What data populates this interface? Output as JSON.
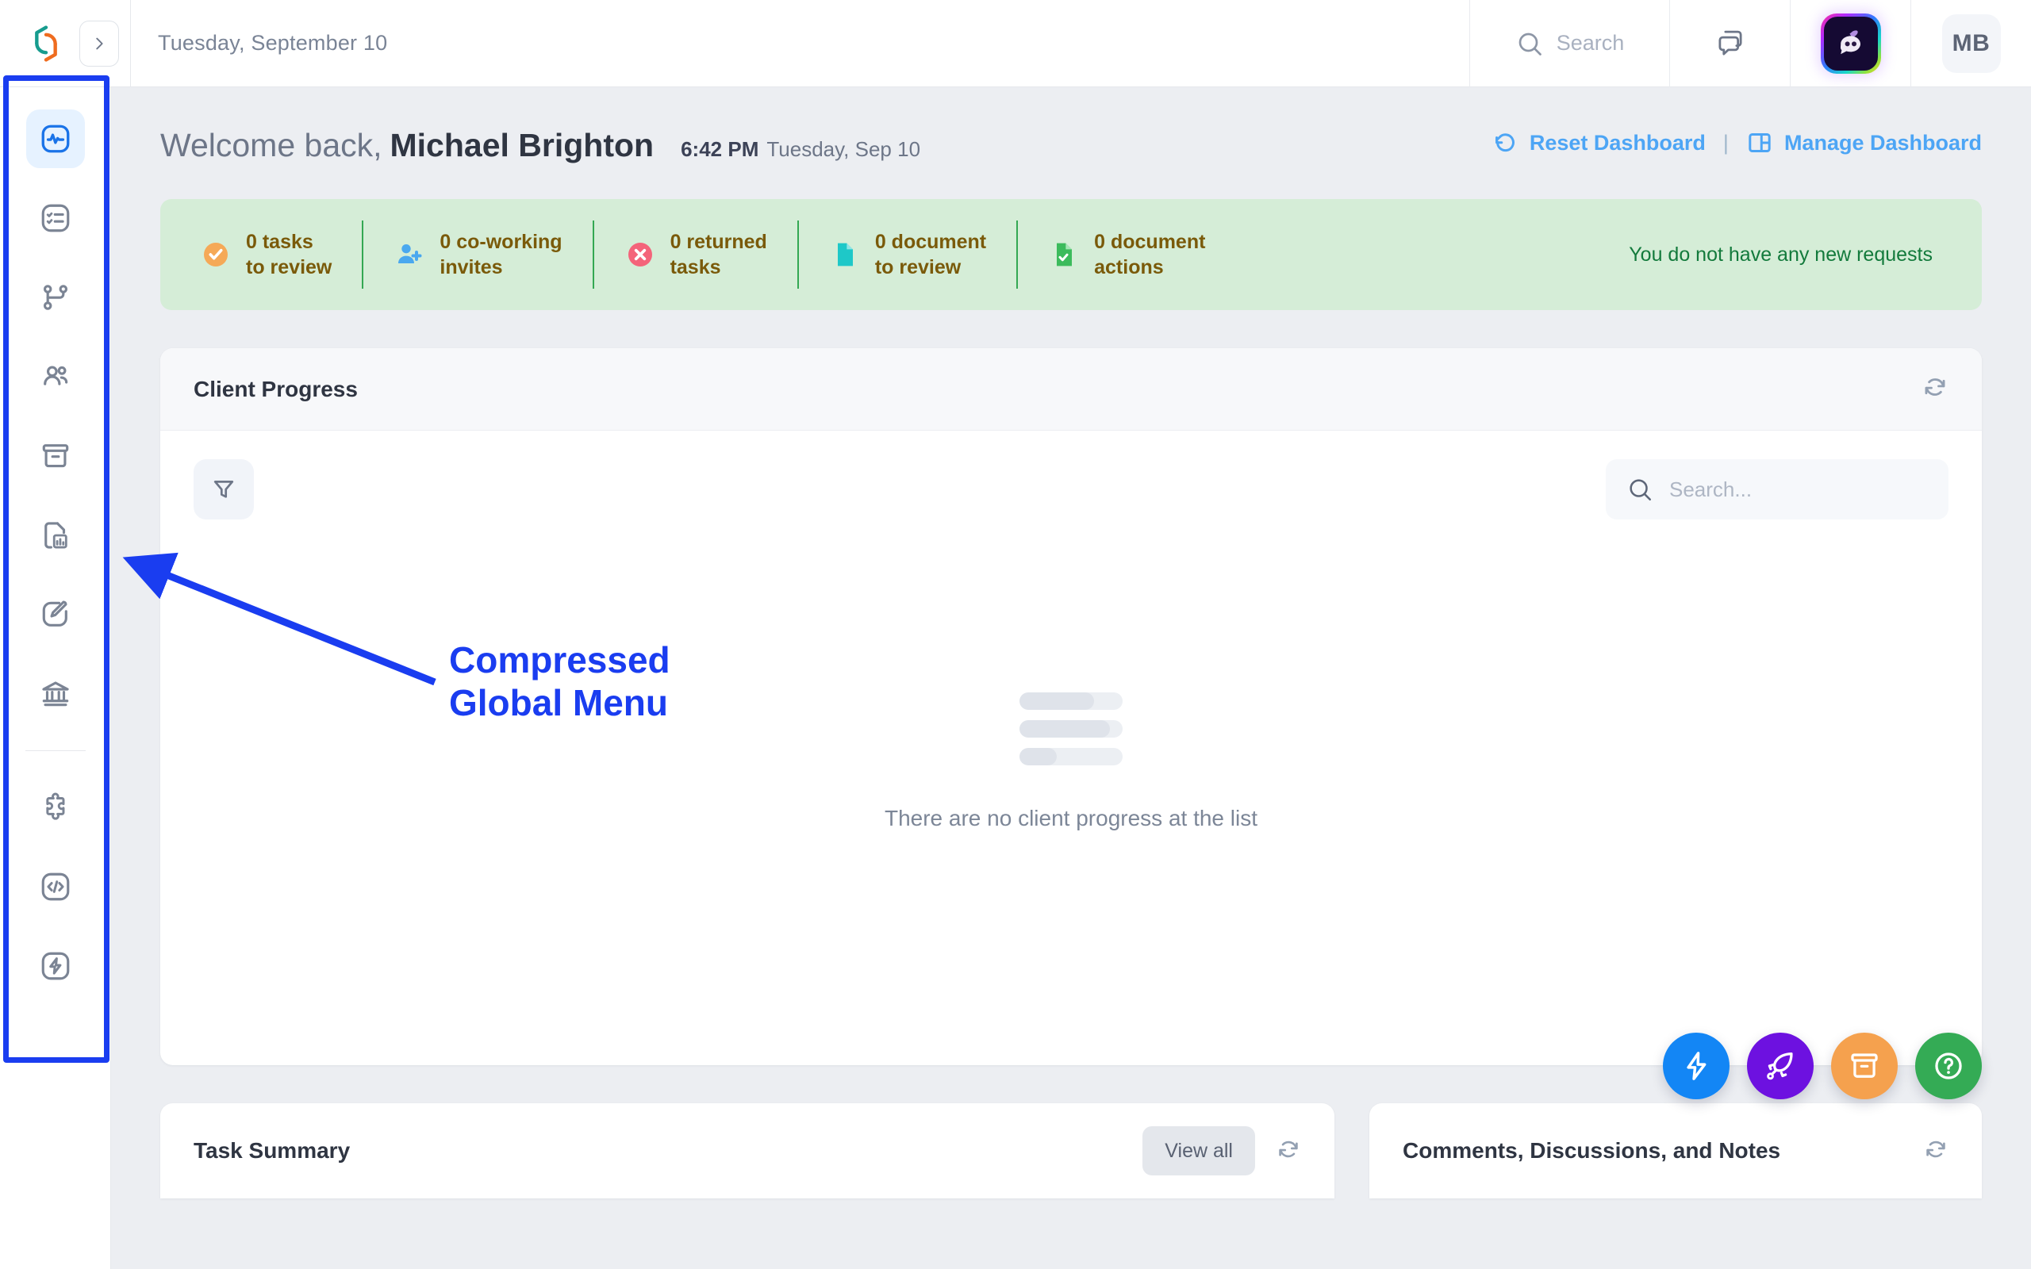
{
  "header": {
    "logo_icon": "app-logo-hexagon",
    "collapse_icon": "chevron-right-icon",
    "date": "Tuesday, September 10",
    "search_label": "Search",
    "search_icon": "search-icon",
    "chat_icon": "chat-bubbles-icon",
    "ai_icon": "ai-assistant-icon",
    "avatar_initials": "MB"
  },
  "sidebar": {
    "items": [
      {
        "name": "sidebar-item-activity",
        "icon": "activity-pulse-icon",
        "active": true
      },
      {
        "name": "sidebar-item-tasks",
        "icon": "checklist-icon",
        "active": false
      },
      {
        "name": "sidebar-item-workflow",
        "icon": "workflow-branch-icon",
        "active": false
      },
      {
        "name": "sidebar-item-clients",
        "icon": "people-icon",
        "active": false
      },
      {
        "name": "sidebar-item-archive",
        "icon": "archive-box-icon",
        "active": false
      },
      {
        "name": "sidebar-item-reports",
        "icon": "document-chart-icon",
        "active": false
      },
      {
        "name": "sidebar-item-editor",
        "icon": "brush-edit-icon",
        "active": false
      },
      {
        "name": "sidebar-item-bank",
        "icon": "bank-institution-icon",
        "active": false
      }
    ],
    "items_bottom": [
      {
        "name": "sidebar-item-integrations",
        "icon": "puzzle-piece-icon",
        "active": false
      },
      {
        "name": "sidebar-item-developer",
        "icon": "code-brackets-icon",
        "active": false
      },
      {
        "name": "sidebar-item-automation",
        "icon": "lightning-bolt-icon",
        "active": false
      }
    ]
  },
  "welcome": {
    "greeting": "Welcome back,",
    "user_name": "Michael Brighton",
    "time": "6:42 PM",
    "date": "Tuesday, Sep 10",
    "reset_label": "Reset Dashboard",
    "reset_icon": "reset-counterclockwise-icon",
    "separator": "|",
    "manage_label": "Manage Dashboard",
    "manage_icon": "layout-panels-icon",
    "link_color": "#4da5f5"
  },
  "notifications": {
    "bg_color": "#d5edd7",
    "items": [
      {
        "count": "0",
        "line1": "0 tasks",
        "line2": "to review",
        "icon": "check-circle-icon",
        "icon_color": "#f5a957"
      },
      {
        "count": "0",
        "line1": "0 co-working",
        "line2": "invites",
        "icon": "user-add-icon",
        "icon_color": "#4aa8ef"
      },
      {
        "count": "0",
        "line1": "0 returned",
        "line2": "tasks",
        "icon": "x-circle-icon",
        "icon_color": "#f4647a"
      },
      {
        "count": "0",
        "line1": "0 document",
        "line2": "to review",
        "icon": "document-icon",
        "icon_color": "#1ec8c8"
      },
      {
        "count": "0",
        "line1": "0 document",
        "line2": "actions",
        "icon": "document-check-icon",
        "icon_color": "#3cbb5c"
      }
    ],
    "message": "You do not have any new requests"
  },
  "client_progress": {
    "title": "Client Progress",
    "refresh_icon": "refresh-icon",
    "filter_icon": "filter-funnel-icon",
    "search_placeholder": "Search...",
    "search_icon": "search-icon",
    "empty_text": "There are no client progress at the list",
    "placeholder_bars": [
      72,
      88,
      36
    ]
  },
  "bottom_cards": [
    {
      "title": "Task Summary",
      "view_all": "View all",
      "refresh_icon": "refresh-icon",
      "has_view_all": true
    },
    {
      "title": "Comments, Discussions, and Notes",
      "refresh_icon": "refresh-icon",
      "has_view_all": false
    }
  ],
  "fabs": [
    {
      "name": "quick-action-fab",
      "icon": "lightning-bolt-icon",
      "color": "#1386f5"
    },
    {
      "name": "launch-fab",
      "icon": "rocket-icon",
      "color": "#6d11e0"
    },
    {
      "name": "archive-fab",
      "icon": "archive-box-icon",
      "color": "#f5a14e"
    },
    {
      "name": "help-fab",
      "icon": "question-circle-icon",
      "color": "#34ab55"
    }
  ],
  "annotation": {
    "text": "Compressed\nGlobal Menu",
    "color": "#1a3df0"
  }
}
